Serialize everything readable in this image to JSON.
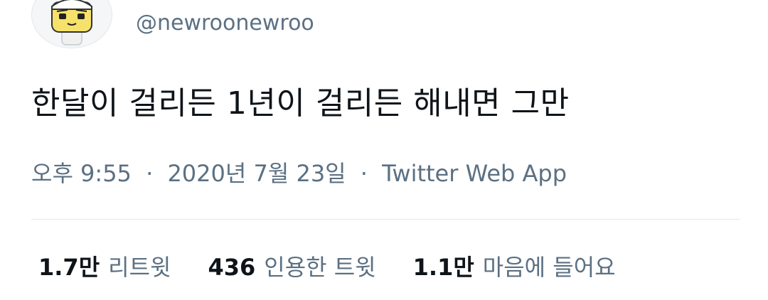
{
  "author": {
    "handle": "@newroonewroo",
    "avatar_icon": "cartoon-character-icon"
  },
  "tweet": {
    "text": "한달이 걸리든 1년이 걸리든 해내면 그만"
  },
  "meta": {
    "time": "오후 9:55",
    "date": "2020년 7월 23일",
    "separator": "·",
    "source": "Twitter Web App"
  },
  "stats": {
    "retweets": {
      "count": "1.7만",
      "label": "리트윗"
    },
    "quote_tweets": {
      "count": "436",
      "label": "인용한 트윗"
    },
    "likes": {
      "count": "1.1만",
      "label": "마음에 들어요"
    }
  },
  "colors": {
    "text_primary": "#0f1419",
    "text_secondary": "#5b7083",
    "divider": "#e1e8ed"
  }
}
